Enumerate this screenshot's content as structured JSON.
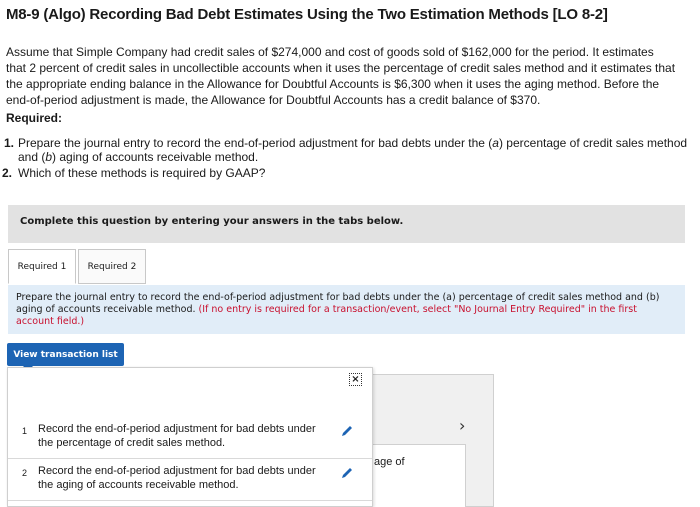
{
  "title": "M8-9 (Algo) Recording Bad Debt Estimates Using the Two Estimation Methods [LO 8-2]",
  "intro": "Assume that Simple Company had credit sales of $274,000 and cost of goods sold of $162,000 for the period. It estimates that 2 percent of credit sales in uncollectible accounts when it uses the percentage of credit sales method and it estimates that the appropriate ending balance in the Allowance for Doubtful Accounts is $6,300 when it uses the aging method. Before the end-of-period adjustment is made, the Allowance for Doubtful Accounts has a credit balance of $370.",
  "required_heading": "Required:",
  "requirements": [
    {
      "num": "1.",
      "text_a": "Prepare the journal entry to record the end-of-period adjustment for bad debts under the (",
      "a": "a",
      "text_b": ") percentage of credit sales method and (",
      "b": "b",
      "text_c": ") aging of accounts receivable method."
    },
    {
      "num": "2.",
      "text": "Which of these methods is required by GAAP?"
    }
  ],
  "banner": "Complete this question by entering your answers in the tabs below.",
  "tabs": [
    "Required 1",
    "Required 2"
  ],
  "prompt": {
    "main": "Prepare the journal entry to record the end-of-period adjustment for bad debts under the (a) percentage of credit sales method and (b) aging of accounts receivable method.",
    "note": "(If no entry is required for a transaction/event, select \"No Journal Entry Required\" in the first account field.)"
  },
  "view_button": "View transaction list",
  "transactions": [
    {
      "num": "1",
      "text": "Record the end-of-period adjustment for bad debts under the percentage of credit sales method."
    },
    {
      "num": "2",
      "text": "Record the end-of-period adjustment for bad debts under the aging of accounts receivable method."
    }
  ],
  "behind_panel_text": "age of",
  "close_glyph": "×",
  "chevron_glyph": "›"
}
